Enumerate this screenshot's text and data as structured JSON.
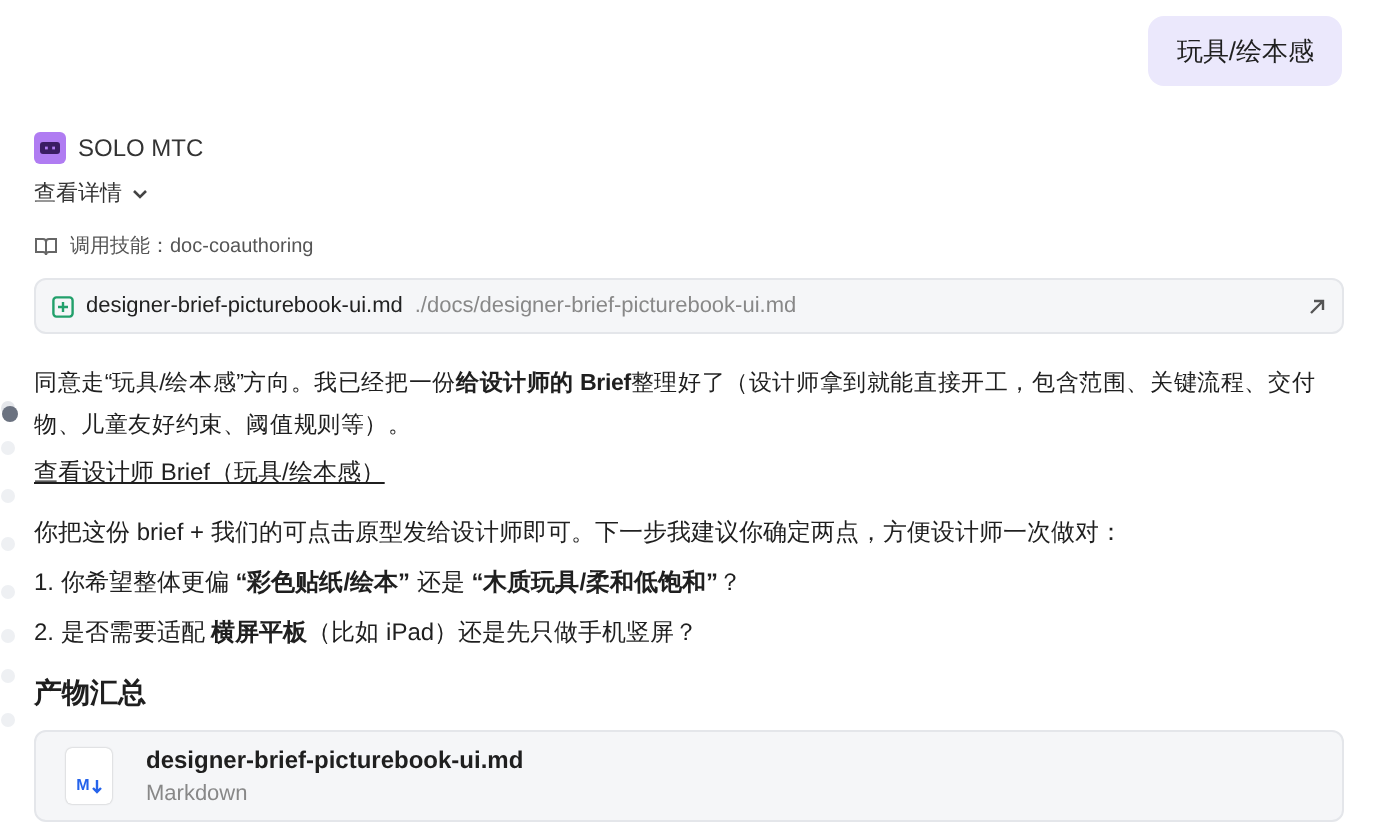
{
  "user_message": "玩具/绘本感",
  "agent": {
    "name": "SOLO MTC"
  },
  "details_toggle": {
    "label": "查看详情",
    "expanded": false
  },
  "skill": {
    "label": "调用技能：doc-coauthoring"
  },
  "file_link": {
    "name": "designer-brief-picturebook-ui.md",
    "path": "./docs/designer-brief-picturebook-ui.md"
  },
  "paragraph": "同意走“玩具/绘本感”方向。我已经把一份**给设计师的 Brief**整理好了（设计师拿到就能直接开工，包含范围、关键流程、交付物、儿童友好约束、阈值规则等）。",
  "link": "查看设计师 Brief（玩具/绘本感）",
  "intro": "你把这份 brief + 我们的可点击原型发给设计师即可。下一步我建议你确定两点，方便设计师一次做对：",
  "questions": [
    "1. 你希望整体更偏 **“彩色贴纸/绘本”** 还是 **“木质玩具/柔和低饱和”**？",
    "2. 是否需要适配 **横屏平板**（比如 iPad）还是先只做手机竖屏？"
  ],
  "summary": {
    "heading": "产物汇总",
    "file": {
      "icon_label": "M",
      "name": "designer-brief-picturebook-ui.md",
      "type": "Markdown"
    }
  }
}
